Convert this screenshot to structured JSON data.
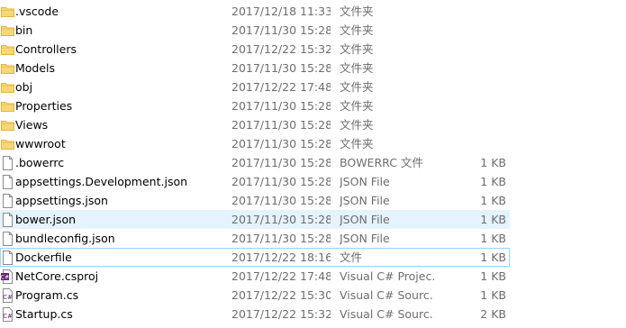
{
  "files": [
    {
      "name": ".vscode",
      "date": "2017/12/18 11:33",
      "type": "文件夹",
      "size": "",
      "icon": "folder-icon"
    },
    {
      "name": "bin",
      "date": "2017/11/30 15:28",
      "type": "文件夹",
      "size": "",
      "icon": "folder-icon"
    },
    {
      "name": "Controllers",
      "date": "2017/12/22 15:32",
      "type": "文件夹",
      "size": "",
      "icon": "folder-icon"
    },
    {
      "name": "Models",
      "date": "2017/11/30 15:28",
      "type": "文件夹",
      "size": "",
      "icon": "folder-icon"
    },
    {
      "name": "obj",
      "date": "2017/12/22 17:48",
      "type": "文件夹",
      "size": "",
      "icon": "folder-icon"
    },
    {
      "name": "Properties",
      "date": "2017/11/30 15:28",
      "type": "文件夹",
      "size": "",
      "icon": "folder-icon"
    },
    {
      "name": "Views",
      "date": "2017/11/30 15:28",
      "type": "文件夹",
      "size": "",
      "icon": "folder-icon"
    },
    {
      "name": "wwwroot",
      "date": "2017/11/30 15:28",
      "type": "文件夹",
      "size": "",
      "icon": "folder-icon"
    },
    {
      "name": ".bowerrc",
      "date": "2017/11/30 15:28",
      "type": "BOWERRC 文件",
      "size": "1 KB",
      "icon": "file-icon"
    },
    {
      "name": "appsettings.Development.json",
      "date": "2017/11/30 15:28",
      "type": "JSON File",
      "size": "1 KB",
      "icon": "file-icon"
    },
    {
      "name": "appsettings.json",
      "date": "2017/11/30 15:28",
      "type": "JSON File",
      "size": "1 KB",
      "icon": "file-icon"
    },
    {
      "name": "bower.json",
      "date": "2017/11/30 15:28",
      "type": "JSON File",
      "size": "1 KB",
      "icon": "file-icon",
      "state": "hover"
    },
    {
      "name": "bundleconfig.json",
      "date": "2017/11/30 15:28",
      "type": "JSON File",
      "size": "1 KB",
      "icon": "file-icon"
    },
    {
      "name": "Dockerfile",
      "date": "2017/12/22 18:16",
      "type": "文件",
      "size": "1 KB",
      "icon": "file-icon",
      "state": "focus"
    },
    {
      "name": "NetCore.csproj",
      "date": "2017/12/22 17:48",
      "type": "Visual C# Projec...",
      "size": "1 KB",
      "icon": "csproj-icon"
    },
    {
      "name": "Program.cs",
      "date": "2017/12/22 15:30",
      "type": "Visual C# Sourc...",
      "size": "1 KB",
      "icon": "csharp-file-icon"
    },
    {
      "name": "Startup.cs",
      "date": "2017/12/22 15:32",
      "type": "Visual C# Sourc...",
      "size": "2 KB",
      "icon": "csharp-file-icon"
    }
  ],
  "colors": {
    "folder": "#f8d775",
    "folder_dark": "#e3b341",
    "hover": "#e5f3ff",
    "focus_border": "#99d1ff",
    "secondary_text": "#6d6d6d",
    "csharp": "#68217a"
  }
}
